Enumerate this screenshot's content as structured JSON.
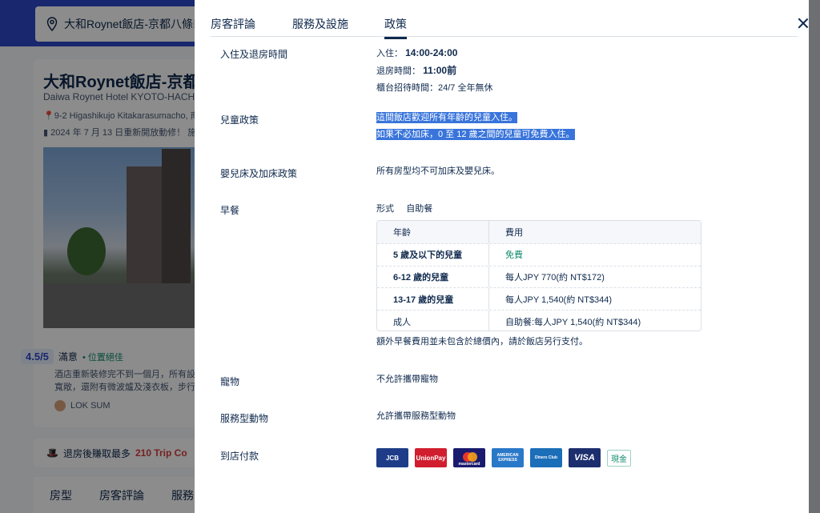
{
  "background": {
    "search_value": "大和Roynet飯店-京都八條口",
    "hotel_name": "大和Roynet飯店-京都八",
    "hotel_name_en": "Daiwa Roynet Hotel KYOTO-HACH",
    "address": "9-2 Higashikujo Kitakarasumacho, 南",
    "renovation": "2024 年 7 月 13 日重新開放動修！ 施",
    "score": "4.5/5",
    "score_text": "滿意",
    "location_text": "位置絕佳",
    "review_snippet": "酒店重新裝修完不到一個月，所有設 寬敞，還附有微波爐及淺衣板，步行",
    "reviewer": "LOK SUM",
    "promo_prefix": "退房後賺取最多",
    "promo_amount": "210 Trip Co",
    "tabs": [
      "房型",
      "房客評論",
      "服務"
    ]
  },
  "modal": {
    "tabs": [
      {
        "label": "房客評論"
      },
      {
        "label": "服務及設施"
      },
      {
        "label": "政策",
        "active": true
      }
    ],
    "checkin": {
      "label": "入住及退房時間",
      "checkin_prefix": "入住：",
      "checkin_value": "14:00-24:00",
      "checkout_prefix": "退房時間：",
      "checkout_value": "11:00前",
      "frontdesk": "櫃台招待時間：24/7 全年無休"
    },
    "children": {
      "label": "兒童政策",
      "line1": "這間飯店歡迎所有年齡的兒童入住。",
      "line2": "如果不必加床，0 至 12 歲之間的兒童可免費入住。"
    },
    "crib": {
      "label": "嬰兒床及加床政策",
      "value": "所有房型均不可加床及嬰兒床。"
    },
    "breakfast": {
      "label": "早餐",
      "type_label": "形式",
      "type_value": "自助餐",
      "header": [
        "年齡",
        "費用"
      ],
      "rows": [
        {
          "age": "5 歲及以下的兒童",
          "fee": "免費"
        },
        {
          "age": "6-12 歲的兒童",
          "fee": "每人JPY 770(約 NT$172)"
        },
        {
          "age": "13-17 歲的兒童",
          "fee": "每人JPY 1,540(約 NT$344)"
        },
        {
          "age": "成人",
          "fee": "自助餐:每人JPY 1,540(約 NT$344)"
        }
      ],
      "note": "額外早餐費用並未包含於總價內，請於飯店另行支付。"
    },
    "pets": {
      "label": "寵物",
      "value": "不允許攜帶寵物"
    },
    "service_animals": {
      "label": "服務型動物",
      "value": "允許攜帶服務型動物"
    },
    "payment": {
      "label": "到店付款",
      "cards": [
        "JCB",
        "UnionPay",
        "mastercard",
        "AMERICAN EXPRESS",
        "Diners Club",
        "VISA"
      ],
      "cash": "現金"
    }
  }
}
